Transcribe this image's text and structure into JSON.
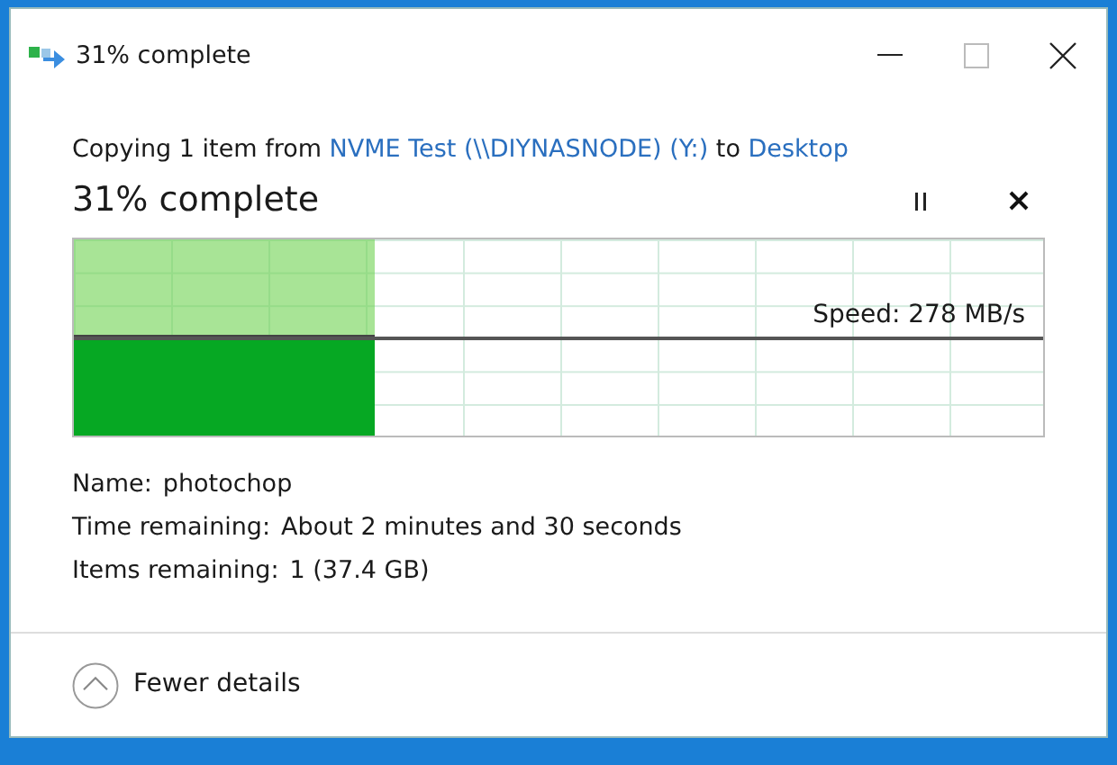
{
  "window": {
    "title": "31% complete"
  },
  "message": [
    {
      "kind": "text",
      "text": "Copying 1 item from "
    },
    {
      "kind": "link",
      "text": "NVME Test (\\\\DIYNASNODE) (Y:)"
    },
    {
      "kind": "text",
      "text": " to "
    },
    {
      "kind": "link",
      "text": "Desktop"
    }
  ],
  "progress": {
    "heading": "31% complete",
    "speed": "Speed: 278 MB/s",
    "level": 0.31
  },
  "details": [
    {
      "label": "Name:",
      "value": "photochop"
    },
    {
      "label": "Time remaining:",
      "value": "About 2 minutes and 30 seconds"
    },
    {
      "label": "Items remaining:",
      "value": "1 (37.4 GB)"
    }
  ],
  "footer": {
    "toggle": "Fewer details",
    "expanded": true
  }
}
